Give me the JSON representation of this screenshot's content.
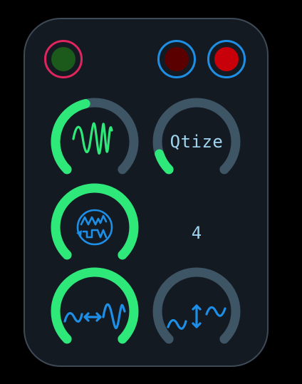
{
  "colors": {
    "panel_bg": "#141a21",
    "panel_border": "#3e4a56",
    "track": "#3e5566",
    "active_arc": "#2ee87a",
    "icon_blue": "#1e8fe6",
    "label_text": "#9fd4f0",
    "led_ring_pink": "#e0245e",
    "led_ring_blue": "#1e8fe6"
  },
  "leds": [
    {
      "name": "led-green",
      "ring": "#e0245e",
      "fill": "#1c5a1c",
      "state": "on"
    },
    {
      "name": "led-dark-red",
      "ring": "#1e8fe6",
      "fill": "#5a0000",
      "state": "dim"
    },
    {
      "name": "led-red",
      "ring": "#1e8fe6",
      "fill": "#c8000a",
      "state": "on"
    }
  ],
  "knobs": [
    {
      "name": "frequency-knob",
      "icon": "chirp-wave-icon",
      "value": 0.45,
      "label": ""
    },
    {
      "name": "quantize-knob",
      "icon": "",
      "value": 0.1,
      "label": "Qtize"
    },
    {
      "name": "waveform-knob",
      "icon": "waveform-cycle-icon",
      "value": 1.0,
      "label": ""
    },
    {
      "name": "width-knob",
      "icon": "horizontal-stretch-icon",
      "value": 1.0,
      "label": ""
    },
    {
      "name": "height-knob",
      "icon": "vertical-stretch-icon",
      "value": 0.0,
      "label": ""
    }
  ],
  "readout": {
    "value": "4"
  }
}
